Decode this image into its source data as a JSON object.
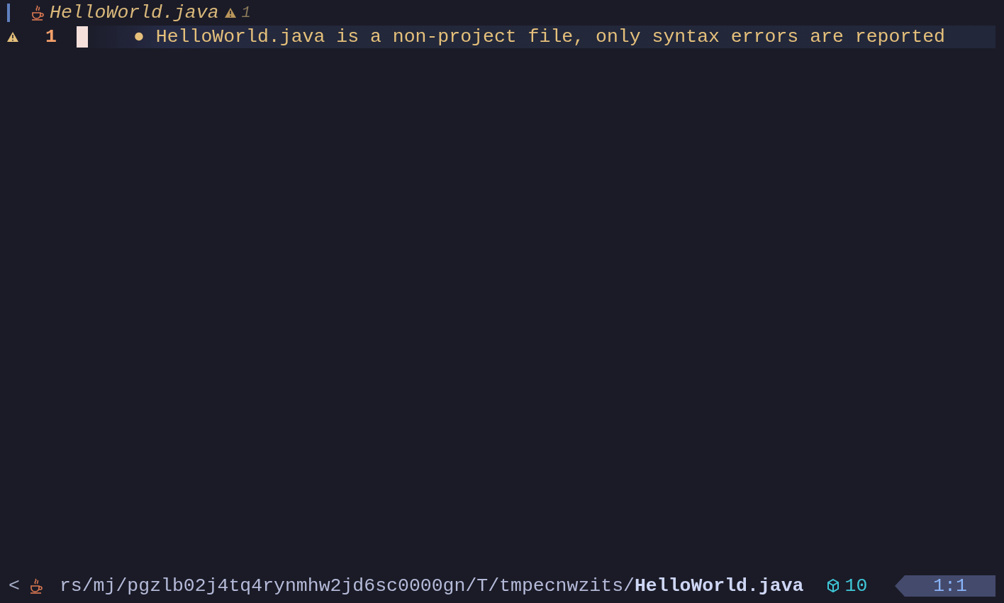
{
  "tabline": {
    "file_name": "HelloWorld.java",
    "warning_count": "1"
  },
  "lines": [
    {
      "number": "1",
      "current": true,
      "diagnostic": "● HelloWorld.java is a non-project file, only syntax errors are reported"
    }
  ],
  "status_bar": {
    "back": "<",
    "path": "rs/mj/pgzlb02j4tq4rynmhw2jd6sc0000gn/T/tmpecnwzits/",
    "file_name": "HelloWorld.java",
    "package_count": "10",
    "position": "1:1"
  }
}
